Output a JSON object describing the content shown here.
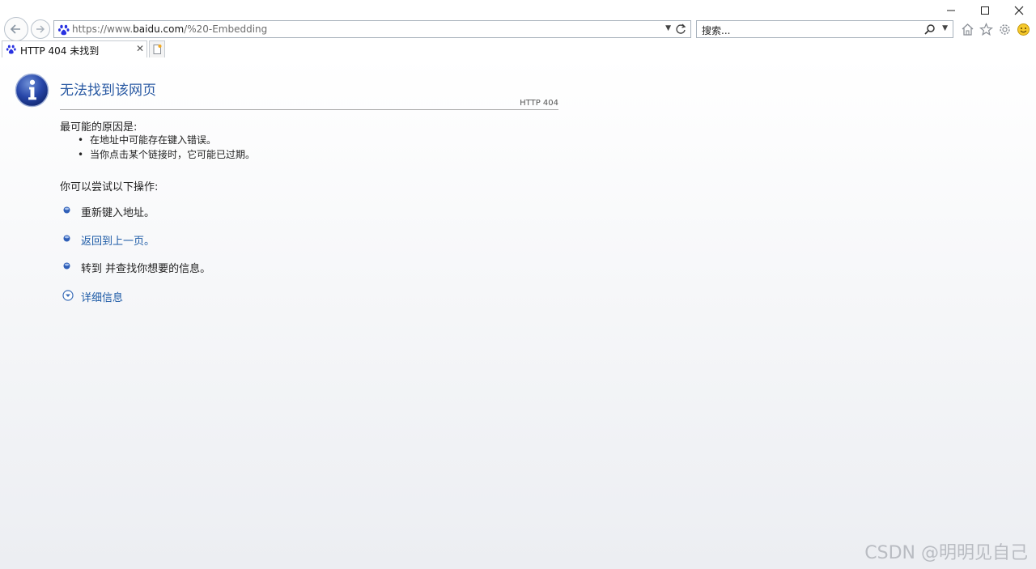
{
  "browser": {
    "address": {
      "prefix": "https://www.",
      "domain": "baidu.com",
      "path": "/%20-Embedding"
    },
    "search": {
      "placeholder": "搜索..."
    },
    "tab": {
      "title": "HTTP 404 未找到",
      "close": "✕"
    },
    "icons": [
      "back-arrow-icon",
      "forward-arrow-icon",
      "baidu-paw-icon",
      "refresh-icon",
      "search-icon",
      "home-icon",
      "favorites-star-icon",
      "settings-gear-icon",
      "smiley-feedback-icon",
      "new-tab-icon",
      "info-icon"
    ]
  },
  "page": {
    "title": "无法找到该网页",
    "code": "HTTP 404",
    "reason_heading": "最可能的原因是:",
    "reasons": [
      "在地址中可能存在键入错误。",
      "当你点击某个链接时，它可能已过期。"
    ],
    "try_heading": "你可以尝试以下操作:",
    "actions": [
      "重新键入地址。",
      "返回到上一页。",
      "转到  并查找你想要的信息。"
    ],
    "details": "详细信息"
  },
  "watermark": "CSDN @明明见自己",
  "colors": {
    "link": "#1c5aa6",
    "title": "#2a5aa3"
  }
}
